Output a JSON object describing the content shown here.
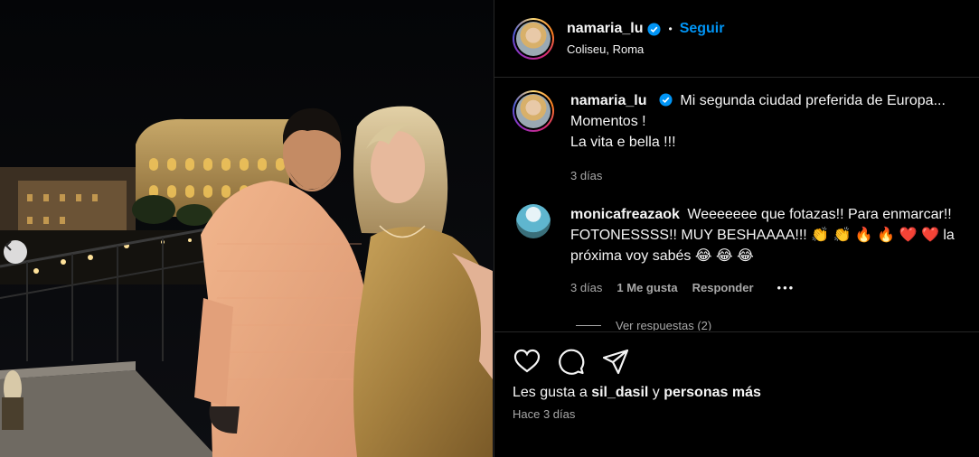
{
  "post": {
    "username": "namaria_lu",
    "dot": "•",
    "follow_label": "Seguir",
    "location": "Coliseu, Roma"
  },
  "caption": {
    "username": "namaria_lu",
    "line1": "Mi segunda ciudad preferida de Europa...",
    "line2": "Momentos !",
    "line3": "La vita e bella !!!",
    "time": "3 días"
  },
  "comment1": {
    "username": "monicafreazaok",
    "text1": "Weeeeeee que fotazas!! Para enmarcar!!",
    "text2": "FOTONESSSS!! MUY BESHAAAA!!!",
    "emoji1": "👏 👏 🔥 🔥 ❤️ ❤️",
    "text3": "la",
    "text4": "próxima voy sabés",
    "emoji2": "😂 😂 😂",
    "time": "3 días",
    "likes": "1 Me gusta",
    "reply": "Responder",
    "more": "•••"
  },
  "view_replies": "Ver respuestas (2)",
  "likes_line": {
    "prefix": "Les gusta a",
    "user": "sil_dasil",
    "middle": "y",
    "suffix": "personas más"
  },
  "post_time": "Hace 3 días",
  "icons": {
    "like": "heart-icon",
    "comment": "comment-icon",
    "share": "share-icon",
    "verified": "verified-badge-icon",
    "prev": "chevron-left-icon"
  },
  "colors": {
    "accent": "#0095f6",
    "background": "#000000",
    "muted": "#a8a8a8",
    "border": "#262626"
  }
}
